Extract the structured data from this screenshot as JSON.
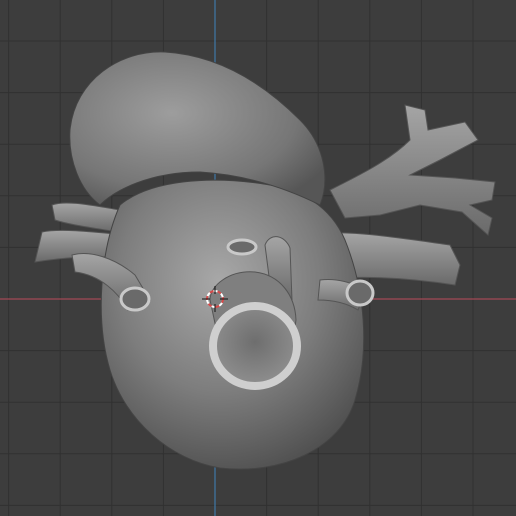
{
  "viewport": {
    "background_color": "#3d3d3d",
    "grid_color": "#313131",
    "x_axis_color": "#a34a55",
    "y_axis_color": "#3f79a8",
    "grid_visible": true
  },
  "object": {
    "kind": "anatomical heart mesh",
    "surface_color": "#9a9a9a",
    "shadow_color": "#4a4a4a",
    "highlight_color": "#bdbdbd"
  },
  "cursor_3d": {
    "icon": "3d-cursor-icon",
    "ring_color_a": "#d94a4a",
    "ring_color_b": "#ffffff"
  }
}
